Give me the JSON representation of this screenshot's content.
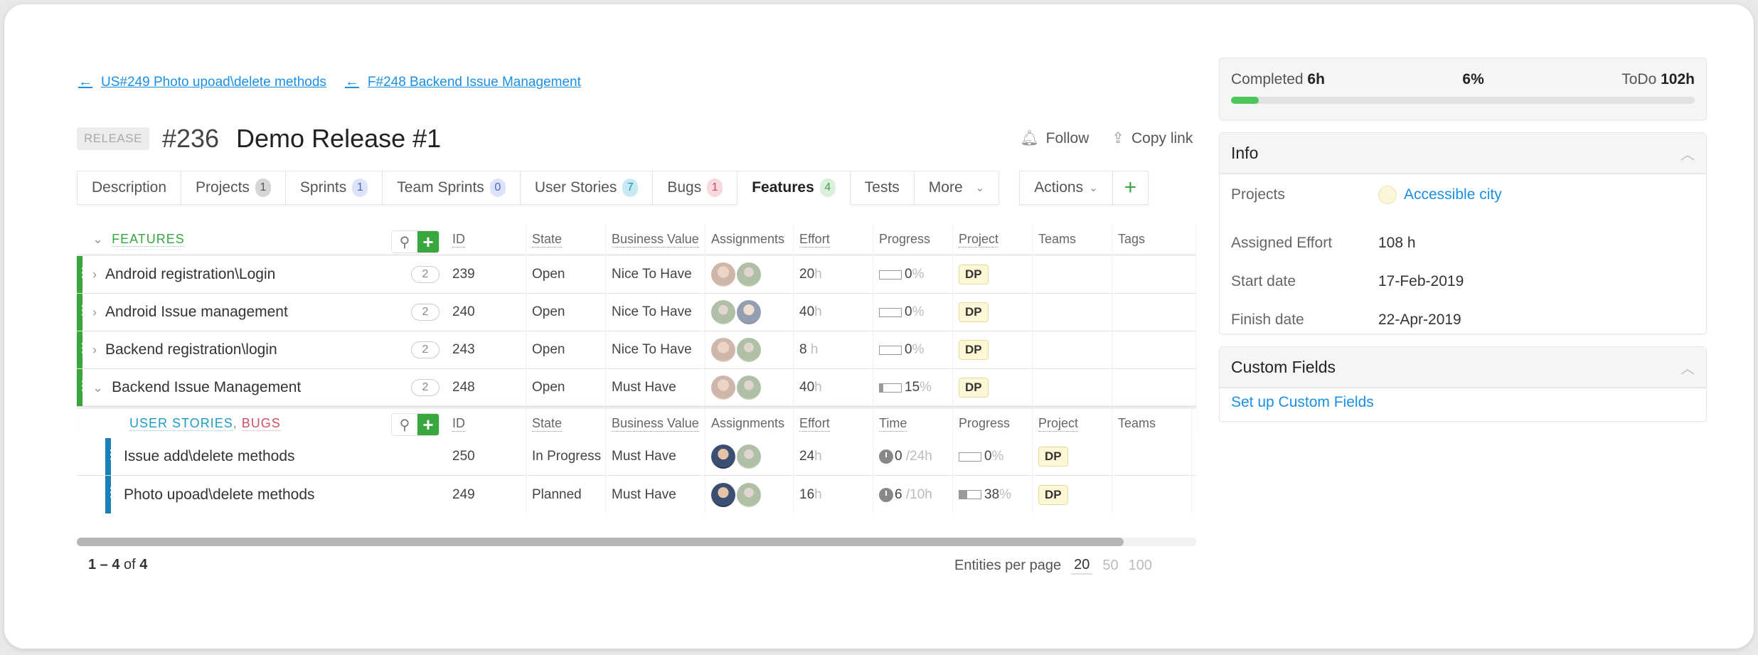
{
  "breadcrumbs": [
    {
      "label": "US#249 Photo upoad\\delete methods"
    },
    {
      "label": "F#248 Backend Issue Management"
    }
  ],
  "title": {
    "entity_type": "RELEASE",
    "id": "#236",
    "name": "Demo Release #1",
    "follow_label": "Follow",
    "copy_link_label": "Copy link"
  },
  "tabs": [
    {
      "label": "Description",
      "count": null
    },
    {
      "label": "Projects",
      "count": "1"
    },
    {
      "label": "Sprints",
      "count": "1"
    },
    {
      "label": "Team Sprints",
      "count": "0"
    },
    {
      "label": "User Stories",
      "count": "7"
    },
    {
      "label": "Bugs",
      "count": "1"
    },
    {
      "label": "Features",
      "count": "4",
      "active": true
    },
    {
      "label": "Tests",
      "count": null
    },
    {
      "label": "More",
      "count": null
    }
  ],
  "actions_label": "Actions",
  "features": {
    "title": "FEATURES",
    "columns": [
      "ID",
      "State",
      "Business Value",
      "Assignments",
      "Effort",
      "Progress",
      "Project",
      "Teams",
      "Tags"
    ],
    "rows": [
      {
        "name": "Android registration\\Login",
        "count": "2",
        "id": "239",
        "state": "Open",
        "business_value": "Nice To Have",
        "effort": "20",
        "effort_unit": "h",
        "progress": "0",
        "project": "DP",
        "expanded": false
      },
      {
        "name": "Android Issue management",
        "count": "2",
        "id": "240",
        "state": "Open",
        "business_value": "Nice To Have",
        "effort": "40",
        "effort_unit": "h",
        "progress": "0",
        "project": "DP",
        "expanded": false
      },
      {
        "name": "Backend registration\\login",
        "count": "2",
        "id": "243",
        "state": "Open",
        "business_value": "Nice To Have",
        "effort": "8",
        "effort_unit": "h",
        "progress": "0",
        "project": "DP",
        "expanded": false
      },
      {
        "name": "Backend Issue Management",
        "count": "2",
        "id": "248",
        "state": "Open",
        "business_value": "Must Have",
        "effort": "40",
        "effort_unit": "h",
        "progress": "15",
        "project": "DP",
        "expanded": true
      }
    ]
  },
  "children": {
    "title_user_stories": "USER STORIES",
    "separator": ",",
    "title_bugs": "BUGS",
    "columns": [
      "ID",
      "State",
      "Business Value",
      "Assignments",
      "Effort",
      "Time",
      "Progress",
      "Project",
      "Teams"
    ],
    "rows": [
      {
        "name": "Issue add\\delete methods",
        "id": "250",
        "state": "In Progress",
        "business_value": "Must Have",
        "effort": "24",
        "effort_unit": "h",
        "time_spent": "0",
        "time_remaining": "/24h",
        "progress": "0",
        "project": "DP"
      },
      {
        "name": "Photo upoad\\delete methods",
        "id": "249",
        "state": "Planned",
        "business_value": "Must Have",
        "effort": "16",
        "effort_unit": "h",
        "time_spent": "6",
        "time_remaining": "/10h",
        "progress": "38",
        "project": "DP"
      }
    ]
  },
  "pager": {
    "range": "1 – 4",
    "of_label": "of",
    "total": "4",
    "per_page_label": "Entities per page",
    "options": [
      "20",
      "50",
      "100"
    ],
    "selected": "20"
  },
  "summary": {
    "completed_label": "Completed",
    "completed_value": "6h",
    "percent": "6%",
    "percent_value": 6,
    "todo_label": "ToDo",
    "todo_value": "102h"
  },
  "info": {
    "title": "Info",
    "rows": [
      {
        "label": "Projects",
        "value": "Accessible city"
      },
      {
        "label": "Assigned Effort",
        "value": "108 h"
      },
      {
        "label": "Start date",
        "value": "17-Feb-2019"
      },
      {
        "label": "Finish date",
        "value": "22-Apr-2019"
      }
    ]
  },
  "custom_fields": {
    "title": "Custom Fields",
    "setup_link": "Set up Custom Fields"
  },
  "colors": {
    "accent_green": "#3aa640",
    "link_blue": "#1a8fe3",
    "user_story_blue": "#1d9bc3",
    "bug_red": "#d05064",
    "progress_green": "#4cc55a"
  }
}
